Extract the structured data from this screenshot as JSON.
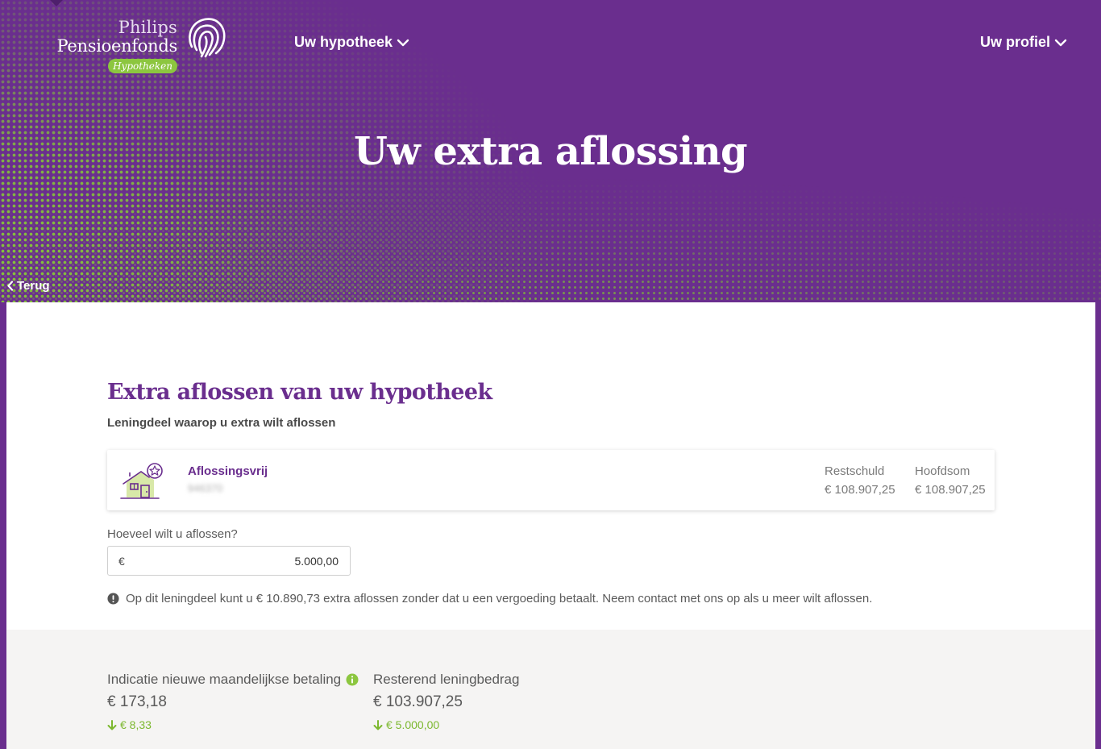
{
  "header": {
    "logo": {
      "line1": "Philips",
      "line2": "Pensioenfonds",
      "badge": "Hypotheken"
    },
    "nav": {
      "hypotheek": "Uw hypotheek",
      "profiel": "Uw profiel"
    },
    "title": "Uw extra aflossing",
    "back": "Terug"
  },
  "main": {
    "title": "Extra aflossen van uw hypotheek",
    "subtitle": "Leningdeel waarop u extra wilt aflossen",
    "loan": {
      "name": "Aflossingsvrij",
      "number": "946370",
      "restschuld_label": "Restschuld",
      "restschuld_value": "€ 108.907,25",
      "hoofdsom_label": "Hoofdsom",
      "hoofdsom_value": "€ 108.907,25"
    },
    "amount": {
      "label": "Hoeveel wilt u aflossen?",
      "currency": "€",
      "value": "5.000,00"
    },
    "notice": "Op dit leningdeel kunt u € 10.890,73 extra aflossen zonder dat u een vergoeding betaalt. Neem contact met ons op als u meer wilt aflossen."
  },
  "summary": {
    "payment": {
      "label": "Indicatie nieuwe maandelijkse betaling",
      "value": "€ 173,18",
      "delta": "€ 8,33"
    },
    "remaining": {
      "label": "Resterend leningbedrag",
      "value": "€ 103.907,25",
      "delta": "€ 5.000,00"
    }
  },
  "colors": {
    "brand_purple": "#6a2e8e",
    "brand_green": "#8cc63f",
    "delta_green": "#7cb82f"
  },
  "icons": [
    "chevron-down-icon",
    "chevron-left-icon",
    "fingerprint-logo-icon",
    "house-star-icon",
    "info-icon",
    "arrow-down-icon"
  ]
}
